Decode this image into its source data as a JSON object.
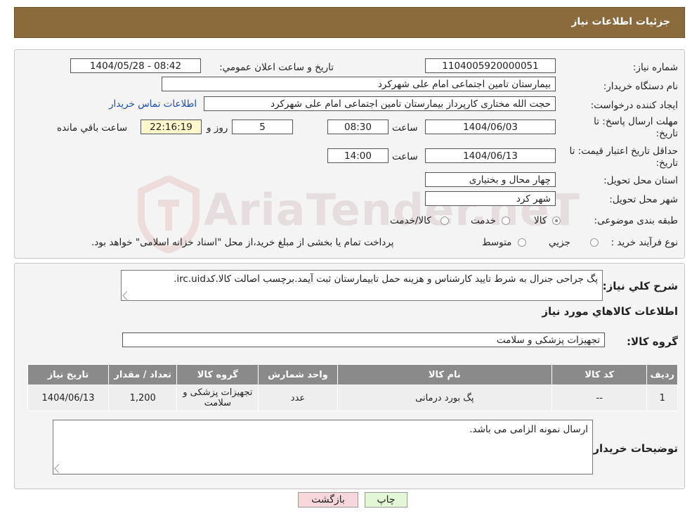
{
  "header": {
    "title": "جزئیات اطلاعات نیاز"
  },
  "watermark": {
    "text": "AriaTender.neT"
  },
  "form": {
    "need_number_label": "شماره نیاز:",
    "need_number": "1104005920000051",
    "announce_label": "تاریخ و ساعت اعلان عمومي:",
    "announce_value": "1404/05/28 - 08:42",
    "buyer_org_label": "نام دستگاه خريدار:",
    "buyer_org": "بیمارستان تامین اجتماعی امام علی شهرکرد",
    "creator_label": "ايجاد کننده درخواست:",
    "creator": "حجت الله مختاری کارپرداز بیمارستان تامین اجتماعی امام علی شهرکرد",
    "contact_link": "اطلاعات تماس خريدار",
    "deadline_label_1": "مهلت ارسال پاسخ: تا",
    "deadline_label_2": "تاریخ:",
    "deadline_date": "1404/06/03",
    "time_label": "ساعت",
    "deadline_time": "08:30",
    "days": "5",
    "days_label": "روز و",
    "remaining_time": "22:16:19",
    "remaining_label": "ساعت باقي مانده",
    "validity_label_1": "حداقل تاریخ اعتبار قیمت: تا",
    "validity_label_2": "تاریخ:",
    "validity_date": "1404/06/13",
    "validity_time": "14:00",
    "province_label": "استان محل تحويل:",
    "province": "چهار محال و بختیاری",
    "city_label": "شهر محل تحويل:",
    "city": "شهر کرد",
    "category_label": "طبقه بندی موضوعی:",
    "category_options": [
      "کالا",
      "خدمت",
      "کالا/خدمت"
    ],
    "category_selected": 0,
    "process_label": "نوع فرآيند خريد :",
    "process_options": [
      "جزیي",
      "متوسط"
    ],
    "process_note": "پرداخت تمام يا بخشی از مبلغ خريد،از محل \"اسناد خزانه اسلامی\" خواهد بود."
  },
  "description": {
    "label": "شرح کلي نياز:",
    "text": "پگ جراحی جنرال به شرط تایید کارشناس و هزینه حمل تابیمارستان ثبت آیمد.برچسب اصالت کالا.کدirc.uid."
  },
  "goods": {
    "title": "اطلاعات کالاهاي مورد نياز",
    "group_label": "گروه کالا:",
    "group_value": "تجهیزات پزشکی و سلامت",
    "columns": [
      "رديف",
      "کد کالا",
      "نام کالا",
      "واحد شمارش",
      "گروه کالا",
      "تعداد / مقدار",
      "تاریخ نیاز"
    ],
    "rows": [
      [
        "1",
        "--",
        "پگ بورد درمانی",
        "عدد",
        "تجهیزات پزشکی و سلامت",
        "1,200",
        "1404/06/13"
      ]
    ]
  },
  "buyer_notes": {
    "label": "توضيحات خريدار:",
    "text": "ارسال نمونه الزامی می باشد."
  },
  "buttons": {
    "print": "چاپ",
    "back": "بازگشت"
  },
  "colors": {
    "header": "#8b6a3c",
    "back_button": "#f8d7da",
    "print_button": "#e3f7d6"
  }
}
